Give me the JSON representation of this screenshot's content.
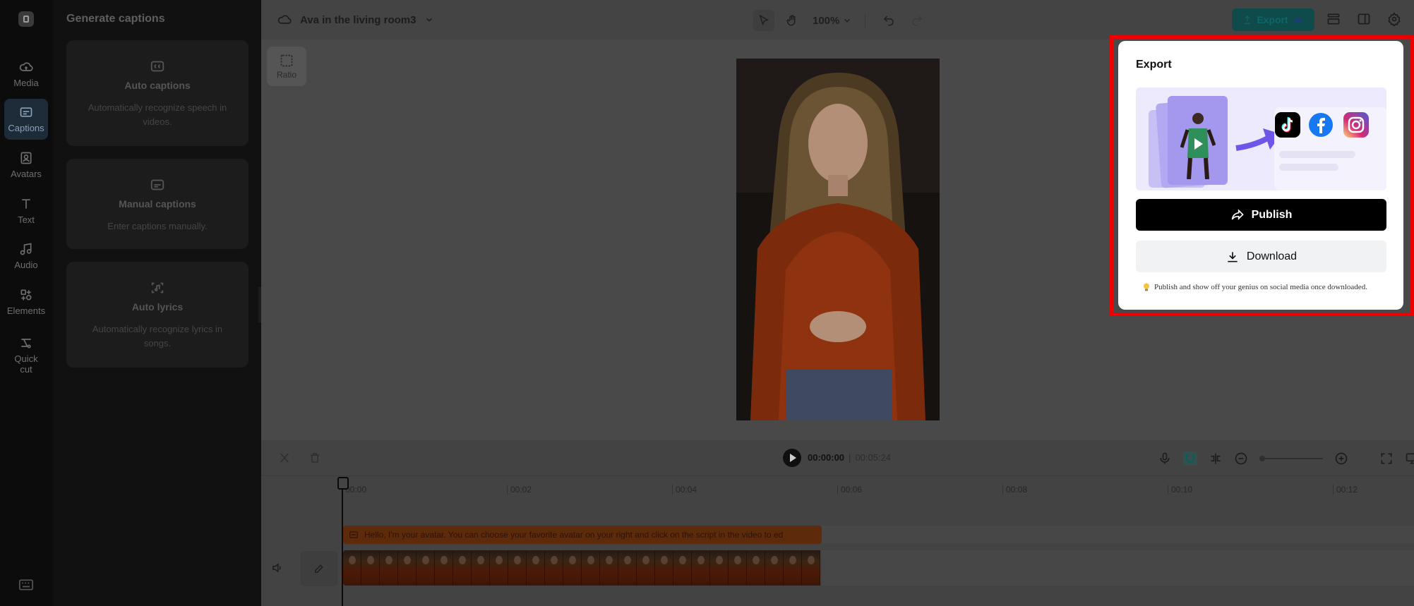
{
  "sidebar": {
    "items": [
      {
        "label": "Media",
        "icon": "cloud-upload-icon"
      },
      {
        "label": "Captions",
        "icon": "captions-icon"
      },
      {
        "label": "Avatars",
        "icon": "avatar-icon"
      },
      {
        "label": "Text",
        "icon": "text-icon"
      },
      {
        "label": "Audio",
        "icon": "music-icon"
      },
      {
        "label": "Elements",
        "icon": "elements-icon"
      },
      {
        "label": "Quick cut",
        "icon": "scissors-icon"
      }
    ],
    "active": "Captions"
  },
  "captions_panel": {
    "title": "Generate captions",
    "cards": [
      {
        "title": "Auto captions",
        "description": "Automatically recognize speech in videos."
      },
      {
        "title": "Manual captions",
        "description": "Enter captions manually."
      },
      {
        "title": "Auto lyrics",
        "description": "Automatically recognize lyrics in songs."
      }
    ]
  },
  "header": {
    "project_name": "Ava in the living room3",
    "zoom": "100%",
    "export_label": "Export"
  },
  "canvas": {
    "ratio_label": "Ratio"
  },
  "timeline": {
    "current_time": "00:00:00",
    "total_time": "00:05:24",
    "ticks": [
      "00:00",
      "00:02",
      "00:04",
      "00:06",
      "00:08",
      "00:10",
      "00:12"
    ],
    "caption_text": "Hello, I'm your avatar. You can choose your favorite avatar on your right and click on the script in the video to ed"
  },
  "export_popup": {
    "title": "Export",
    "publish_label": "Publish",
    "download_label": "Download",
    "tip": "Publish and show off your genius on social media once downloaded.",
    "socials": [
      "tiktok-icon",
      "facebook-icon",
      "instagram-icon"
    ]
  },
  "colors": {
    "accent": "#0e6666",
    "highlight": "#ee0000",
    "caption_track": "#5e2a0c"
  }
}
